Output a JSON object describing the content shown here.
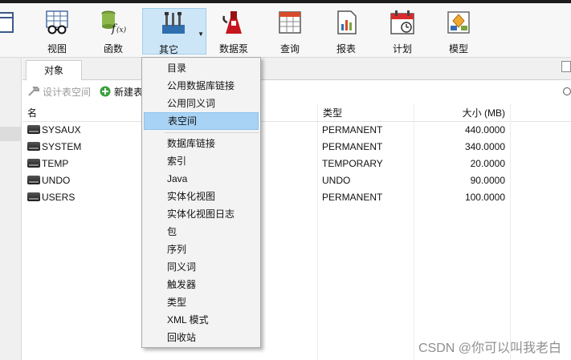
{
  "toolbar": {
    "buttons": [
      {
        "label": "视图",
        "icon": "view-glasses-icon"
      },
      {
        "label": "函数",
        "icon": "function-fx-icon"
      },
      {
        "label": "其它",
        "icon": "tools-icon"
      },
      {
        "label": "数据泵",
        "icon": "data-pump-icon"
      },
      {
        "label": "查询",
        "icon": "query-table-icon"
      },
      {
        "label": "报表",
        "icon": "report-icon"
      },
      {
        "label": "计划",
        "icon": "schedule-calendar-icon"
      },
      {
        "label": "模型",
        "icon": "model-icon"
      }
    ],
    "active": "其它"
  },
  "tabs": {
    "objects": "对象"
  },
  "object_toolbar": {
    "design_tablespace": "设计表空间",
    "new_tablespace": "新建表"
  },
  "table": {
    "columns": [
      "名",
      "类型",
      "大小 (MB)"
    ],
    "rows": [
      {
        "name": "SYSAUX",
        "type": "PERMANENT",
        "size": "440.0000"
      },
      {
        "name": "SYSTEM",
        "type": "PERMANENT",
        "size": "340.0000"
      },
      {
        "name": "TEMP",
        "type": "TEMPORARY",
        "size": "20.0000"
      },
      {
        "name": "UNDO",
        "type": "UNDO",
        "size": "90.0000"
      },
      {
        "name": "USERS",
        "type": "PERMANENT",
        "size": "100.0000"
      }
    ]
  },
  "menu": {
    "items": [
      "目录",
      "公用数据库链接",
      "公用同义词",
      "表空间",
      "数据库链接",
      "索引",
      "Java",
      "实体化视图",
      "实体化视图日志",
      "包",
      "序列",
      "同义词",
      "触发器",
      "类型",
      "XML 模式",
      "回收站"
    ],
    "highlighted": "表空间"
  },
  "colors": {
    "accent": "#a8d3f5",
    "active_button": "#cde6f7"
  },
  "watermark": "CSDN @你可以叫我老白"
}
